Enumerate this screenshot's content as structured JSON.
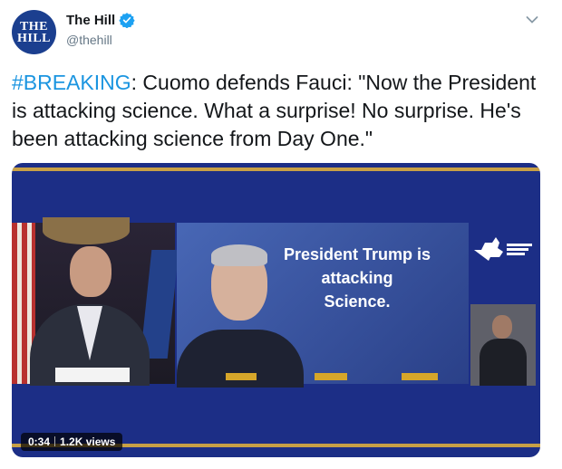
{
  "account": {
    "avatar_line1": "THE",
    "avatar_line2": "HILL",
    "name": "The Hill",
    "handle": "@thehill",
    "verified_icon": "verified-badge-icon",
    "menu_icon": "chevron-down-icon"
  },
  "tweet": {
    "hashtag": "#BREAKING",
    "text": ": Cuomo defends Fauci: \"Now the President is attacking science. What a surprise! No surprise. He's been attacking science from Day One.\""
  },
  "video": {
    "overlay_line1": "President Trump is",
    "overlay_line2": "attacking",
    "overlay_line3": "Science.",
    "duration": "0:34",
    "views": "1.2K views"
  },
  "colors": {
    "accent": "#1b95e0",
    "video_bg": "#1c2e86",
    "gold": "#c8a046"
  }
}
